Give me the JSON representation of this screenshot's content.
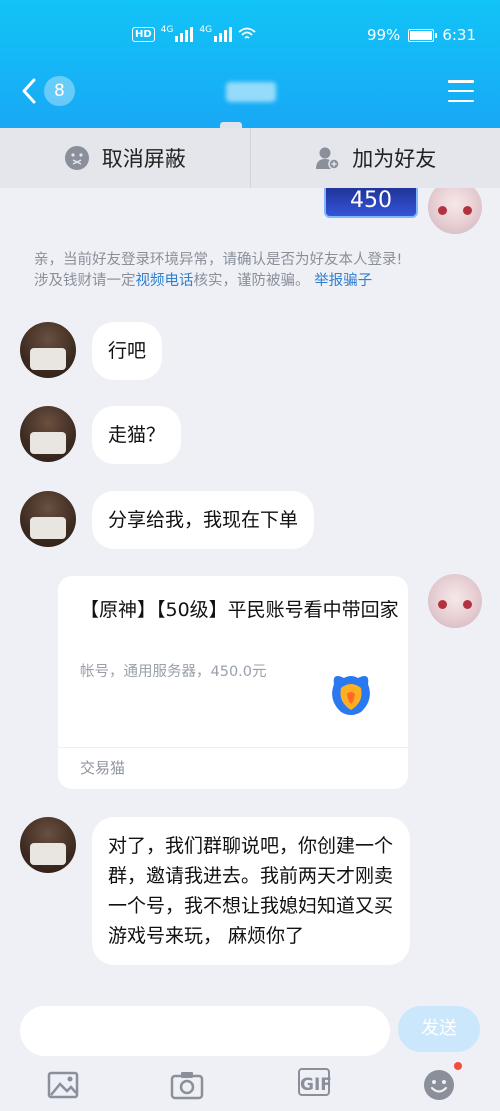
{
  "status_bar": {
    "hd_label": "HD",
    "signal_1_label": "4G",
    "signal_2_label": "4G",
    "battery_percent": "99%",
    "time": "6:31"
  },
  "header": {
    "back_count": "8",
    "title": ""
  },
  "action_bar": {
    "unblock_label": "取消屏蔽",
    "add_friend_label": "加为好友"
  },
  "chat": {
    "gift_value": "450",
    "warning": {
      "line1": "亲，当前好友登录环境异常，请确认是否为好友本人登录!",
      "line2_prefix": "涉及钱财请一定",
      "video_call_link": "视频电话",
      "line2_middle": "核实，谨防被骗。",
      "report_link": "举报骗子"
    },
    "messages": [
      {
        "sender": "other",
        "text": "行吧"
      },
      {
        "sender": "other",
        "text": "走猫？"
      },
      {
        "sender": "other",
        "text": "分享给我，我现在下单"
      },
      {
        "sender": "other",
        "text": "对了，我们群聊说吧，你创建一个群，邀请我进去。我前两天才刚卖一个号，我不想让我媳妇知道又买游戏号来玩， 麻烦你了"
      }
    ],
    "card": {
      "title": "【原神】【50级】平民账号看中带回家",
      "subtitle": "帐号，通用服务器，450.0元",
      "source": "交易猫",
      "logo_icon": "jiaoyimao-logo-icon"
    }
  },
  "input_bar": {
    "send_label": "发送",
    "tools": [
      {
        "name": "image-icon"
      },
      {
        "name": "camera-icon"
      },
      {
        "name": "gif-icon",
        "label": "GIF"
      },
      {
        "name": "emoji-icon"
      }
    ]
  },
  "colors": {
    "header_top": "#12c4f7",
    "header_bottom": "#18a8f5",
    "background": "#eef0f6",
    "link": "#2f7fd1",
    "send_button": "#cbe7fb",
    "notification_dot": "#f24d3b"
  }
}
